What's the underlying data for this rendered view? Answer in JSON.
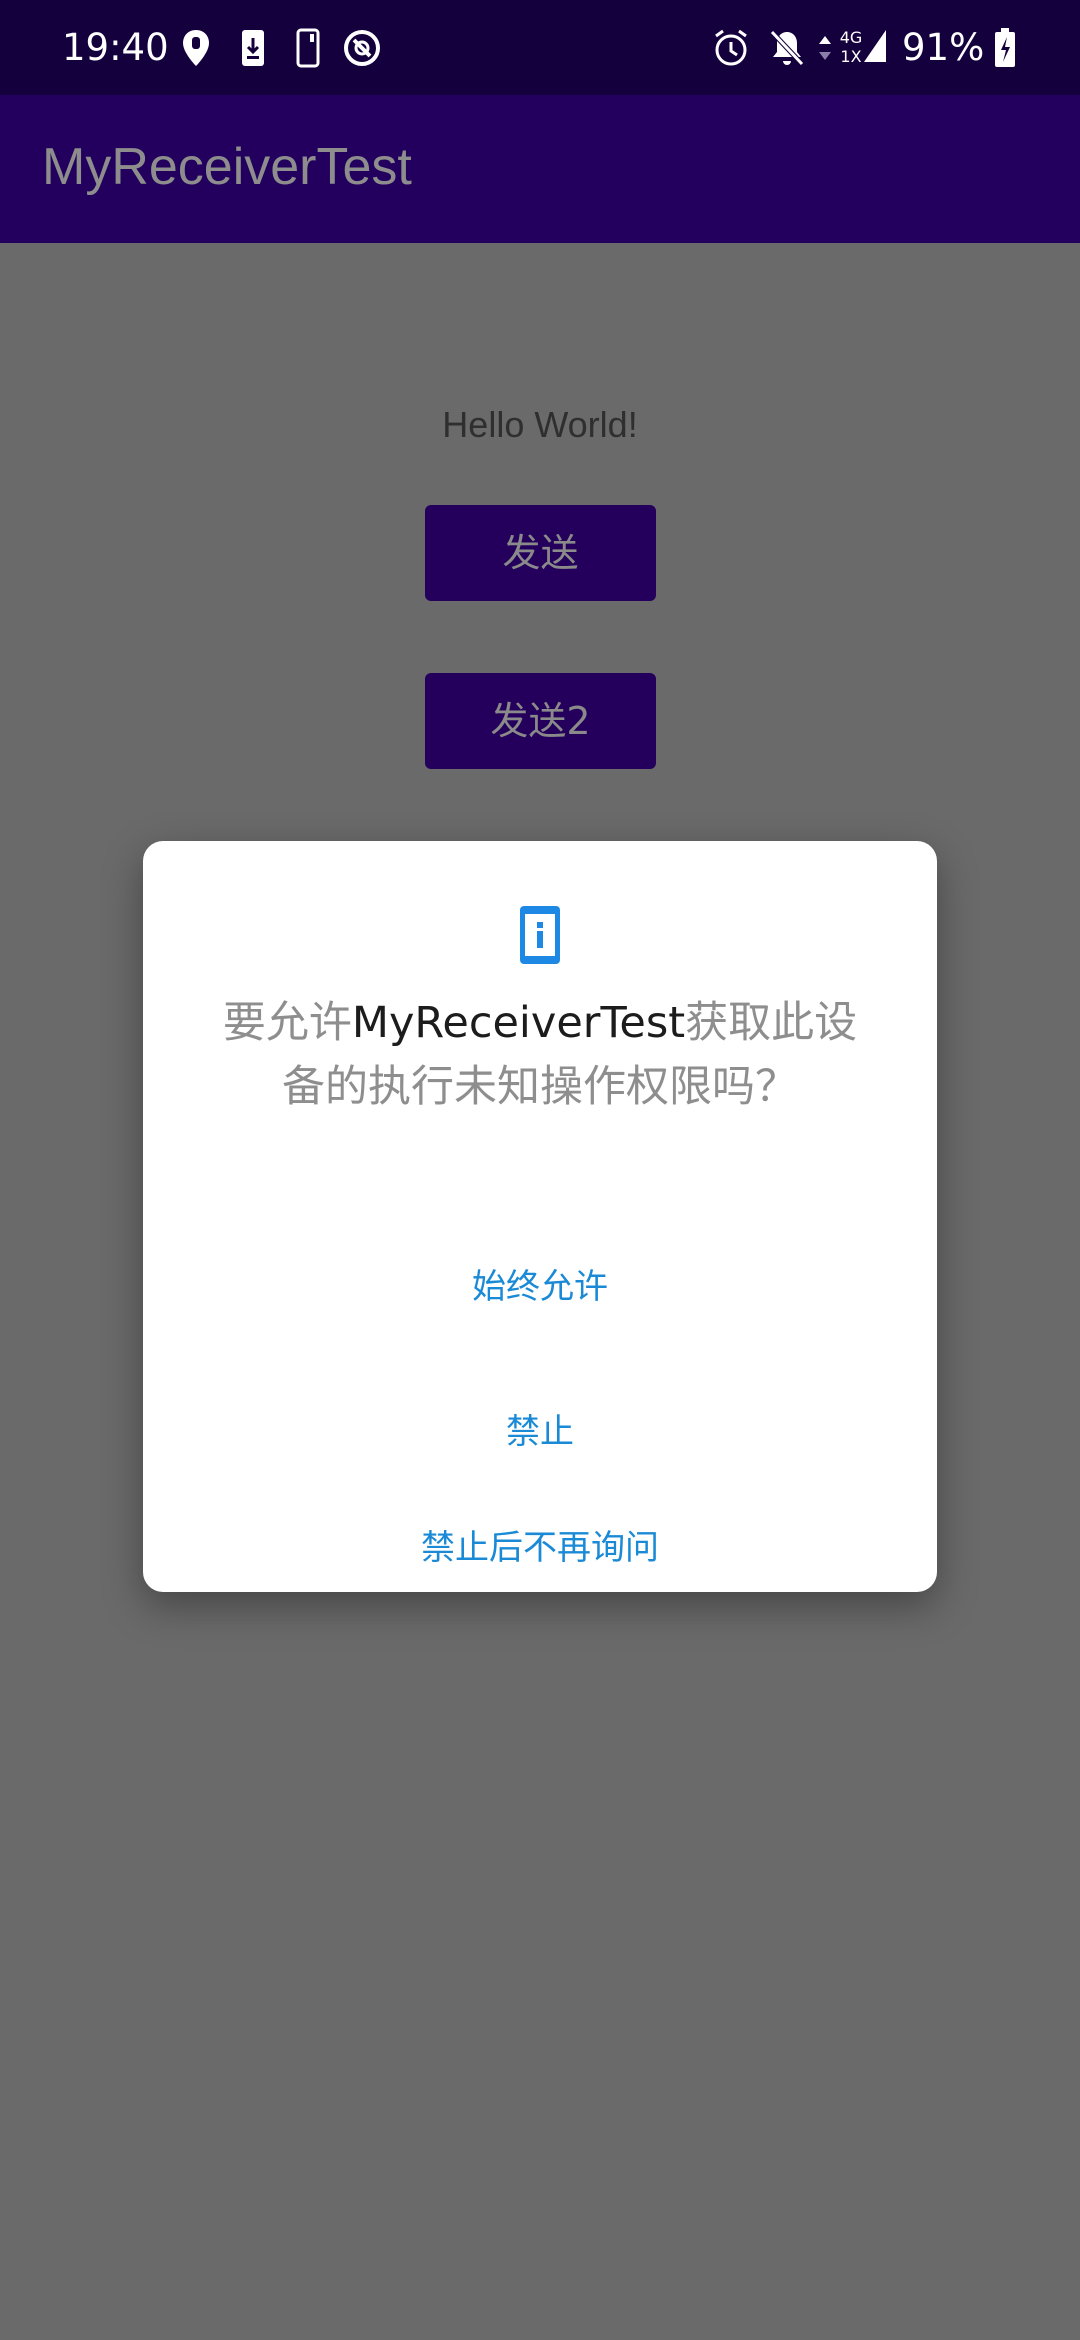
{
  "status_bar": {
    "time": "19:40",
    "battery": "91%",
    "network": {
      "top": "4G",
      "bottom": "1X"
    },
    "icons": [
      "location-pin-icon",
      "download-icon",
      "phone-icon",
      "sync-blocked-icon",
      "alarm-icon",
      "bell-muted-icon",
      "data-arrows-icon",
      "signal-icon",
      "battery-charging-icon"
    ]
  },
  "app_bar": {
    "title": "MyReceiverTest"
  },
  "content": {
    "hello": "Hello World!",
    "buttons": [
      {
        "label": "发送"
      },
      {
        "label": "发送2"
      }
    ]
  },
  "dialog": {
    "icon": "info-phone-icon",
    "message_prefix": "要允许",
    "message_app": "MyReceiverTest",
    "message_suffix": "获取此设备的执行未知操作权限吗？",
    "actions": [
      {
        "label": "始终允许"
      },
      {
        "label": "禁止"
      },
      {
        "label": "禁止后不再询问"
      }
    ]
  },
  "colors": {
    "status_bar": "#14003c",
    "app_bar": "#23005e",
    "button": "#24005c",
    "scrim_background": "#6a6a6a",
    "dialog_action": "#1a8ad6",
    "dialog_icon": "#1e88e5"
  }
}
